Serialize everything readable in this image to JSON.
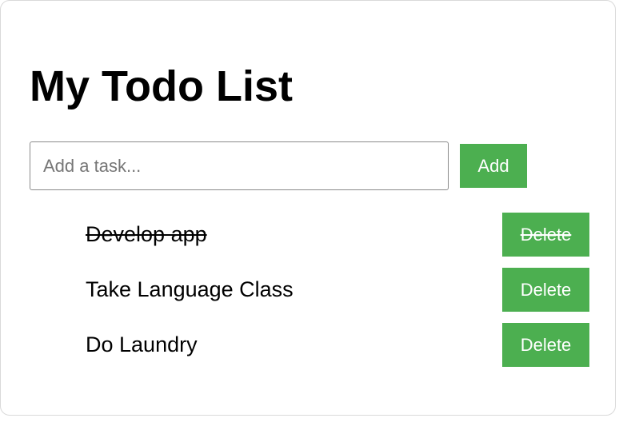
{
  "app": {
    "title": "My Todo List"
  },
  "new_task": {
    "placeholder": "Add a task...",
    "value": "",
    "add_label": "Add"
  },
  "todos": [
    {
      "text": "Develop app",
      "completed": true,
      "delete_label": "Delete"
    },
    {
      "text": "Take Language Class",
      "completed": false,
      "delete_label": "Delete"
    },
    {
      "text": "Do Laundry",
      "completed": false,
      "delete_label": "Delete"
    }
  ],
  "colors": {
    "button_bg": "#4caf50",
    "button_text": "#ffffff",
    "card_border": "#d9d9d9"
  }
}
